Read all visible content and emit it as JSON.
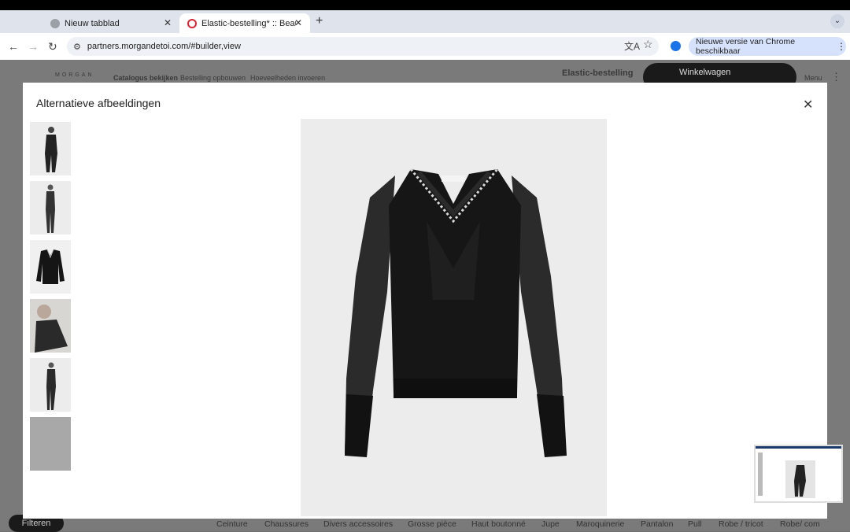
{
  "browser": {
    "tabs": [
      {
        "title": "Nieuw tabblad",
        "active": false
      },
      {
        "title": "Elastic-bestelling* :: Beauman",
        "active": true
      }
    ],
    "url": "partners.morgandetoi.com/#builder,view",
    "update_label": "Nieuwe versie van Chrome beschikbaar"
  },
  "app": {
    "brand": "MORGAN",
    "nav": [
      "Catalogus bekijken",
      "Bestelling opbouwen",
      "Hoeveelheden invoeren"
    ],
    "order_name": "Elastic-bestelling",
    "cart_label": "Winkelwagen",
    "menu_label": "Menu",
    "filter_button": "Filteren",
    "categories": [
      "Ceinture",
      "Chaussures",
      "Divers accessoires",
      "Grosse pièce",
      "Haut boutonné",
      "Jupe",
      "Maroquinerie",
      "Pantalon",
      "Pull",
      "Robe / tricot",
      "Robe/ com"
    ]
  },
  "modal": {
    "title": "Alternatieve afbeeldingen",
    "thumbnail_count": 6
  },
  "colors": {
    "modal_bg": "#ffffff",
    "overlay": "#6f6f6f",
    "garment": "#141414"
  }
}
